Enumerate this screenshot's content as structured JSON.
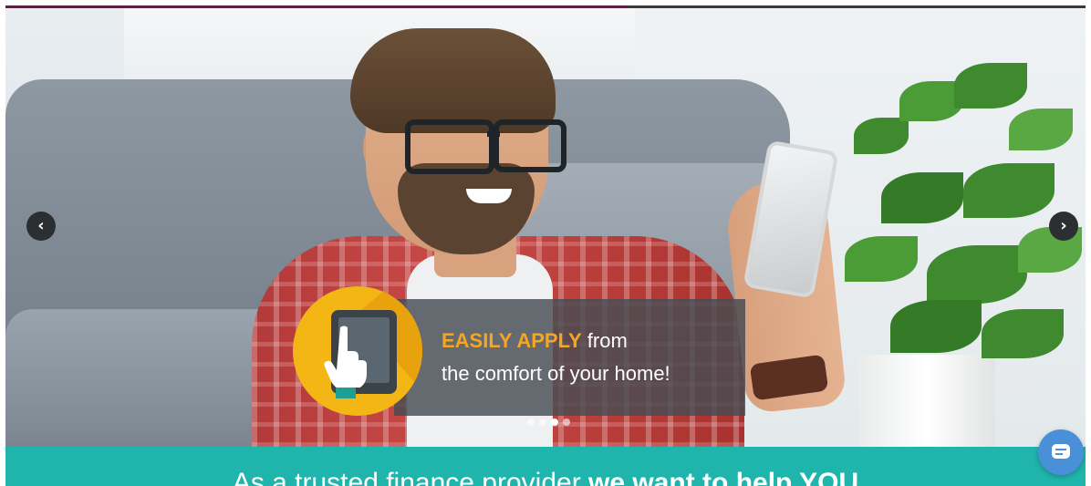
{
  "carousel": {
    "prev_icon": "chevron-left-icon",
    "next_icon": "chevron-right-icon",
    "prev_glyph": "‹",
    "next_glyph": "›",
    "slide_count": 4,
    "active_slide": 3
  },
  "slide": {
    "highlight": "EASILY APPLY",
    "line1_rest": " from",
    "line2": "the comfort of your home!",
    "badge_icon": "tablet-touch-icon"
  },
  "band": {
    "text_normal": "As a trusted finance provider ",
    "text_bold": "we want to help YOU"
  },
  "chat": {
    "icon": "chat-bubble-icon"
  },
  "colors": {
    "accent_orange": "#f5a623",
    "teal": "#1fb5ac",
    "badge_yellow": "#f3b614",
    "chat_blue": "#4a90d9",
    "progress": "#5a2140"
  }
}
